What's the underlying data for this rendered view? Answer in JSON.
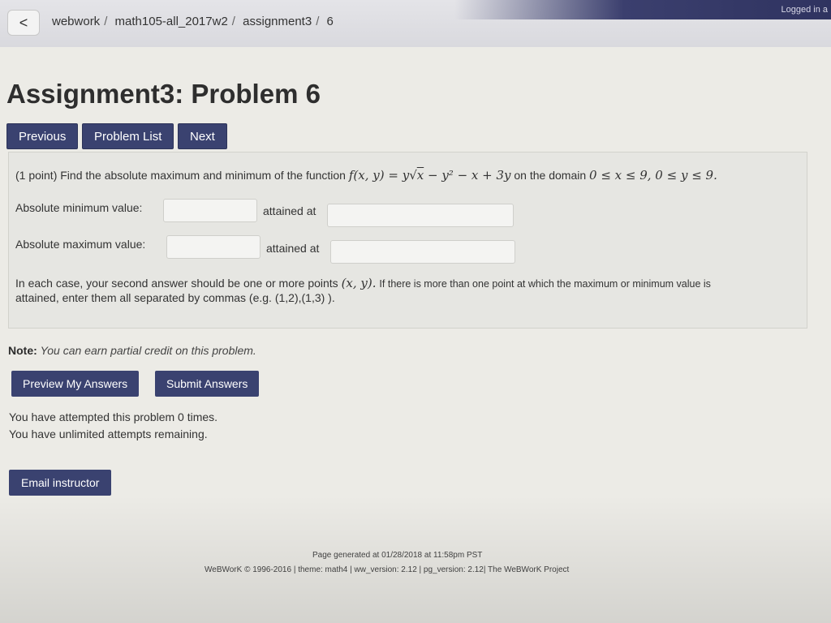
{
  "header": {
    "logged_in_text": "Logged in a",
    "back_glyph": "<",
    "breadcrumb": [
      "webwork",
      "math105-all_2017w2",
      "assignment3",
      "6"
    ],
    "separator": "/"
  },
  "page_title": "Assignment3: Problem 6",
  "nav": {
    "previous": "Previous",
    "problem_list": "Problem List",
    "next": "Next"
  },
  "problem": {
    "points": "(1 point)",
    "statement": "Find the absolute maximum and minimum of the function",
    "function_lhs": "f(x, y) = y",
    "function_sqrt": "x",
    "function_rest": " − y² − x + 3y",
    "domain_text": "on the domain",
    "domain_math": "0 ≤ x ≤ 9,  0 ≤ y ≤ 9.",
    "min_label": "Absolute minimum value:",
    "max_label": "Absolute maximum value:",
    "attained_label": "attained at",
    "min_value": "",
    "min_point": "",
    "max_value": "",
    "max_point": "",
    "instruction_line1_a": "In each case, your second answer should be one or more points",
    "instruction_point": "(x, y).",
    "instruction_line1_b": "If there is more than one point at which the maximum or minimum value is",
    "instruction_line2": "attained, enter them all separated by commas (e.g. (1,2),(1,3) )."
  },
  "note": {
    "label": "Note:",
    "text": "You can earn partial credit on this problem."
  },
  "actions": {
    "preview": "Preview My Answers",
    "submit": "Submit Answers",
    "email": "Email instructor"
  },
  "attempts": {
    "line1": "You have attempted this problem 0 times.",
    "line2": "You have unlimited attempts remaining."
  },
  "footer": {
    "generated": "Page generated at 01/28/2018 at 11:58pm PST",
    "credits": "WeBWorK © 1996-2016 | theme: math4 | ww_version: 2.12 | pg_version: 2.12| The WeBWorK Project"
  },
  "colors": {
    "button": "#3a4270",
    "background": "#ecebe6",
    "panel": "#e6e6e2"
  }
}
